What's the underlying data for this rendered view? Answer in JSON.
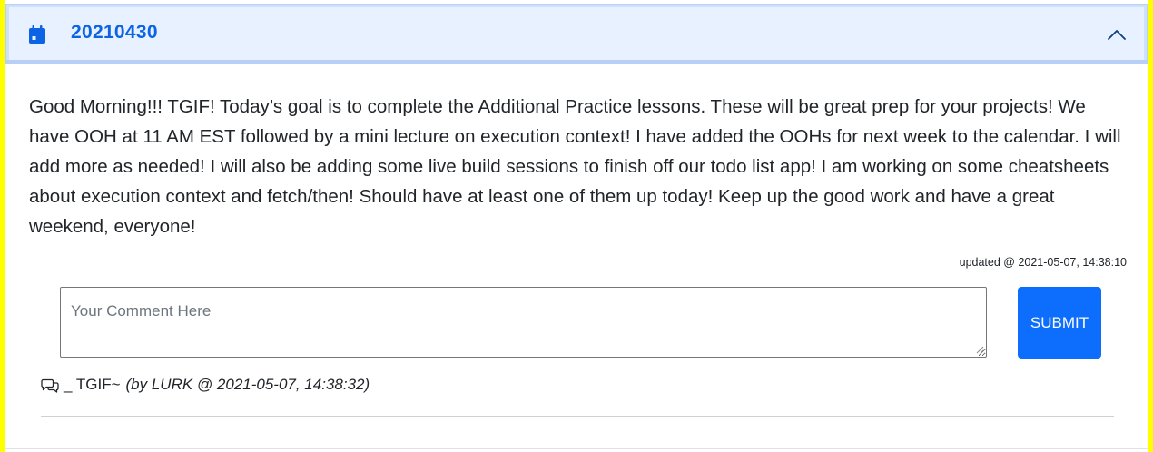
{
  "accordion": {
    "title": "20210430",
    "icon": "calendar-icon",
    "toggle_icon": "chevron-up-icon",
    "expanded": true,
    "accent_color": "#0c63e4",
    "header_bg": "#e7f1ff"
  },
  "post": {
    "body": "Good Morning!!! TGIF! Today’s goal is to complete the Additional Practice lessons. These will be great prep for your projects! We have OOH at 11 AM EST followed by a mini lecture on execution context! I have added the OOHs for next week to the calendar. I will add more as needed! I will also be adding some live build sessions to finish off our todo list app! I am working on some cheatsheets about execution context and fetch/then! Should have at least one of them up today! Keep up the good work and have a great weekend, everyone!",
    "updated": "updated @ 2021-05-07, 14:38:10"
  },
  "comment_form": {
    "placeholder": "Your Comment Here",
    "value": "",
    "submit_label": "SUBMIT",
    "submit_color": "#0d6efd"
  },
  "comments": [
    {
      "icon": "chat-bubbles-icon",
      "text": "_ TGIF~",
      "meta": "(by LURK @ 2021-05-07, 14:38:32)"
    }
  ],
  "page": {
    "border_color": "#ffff00"
  }
}
